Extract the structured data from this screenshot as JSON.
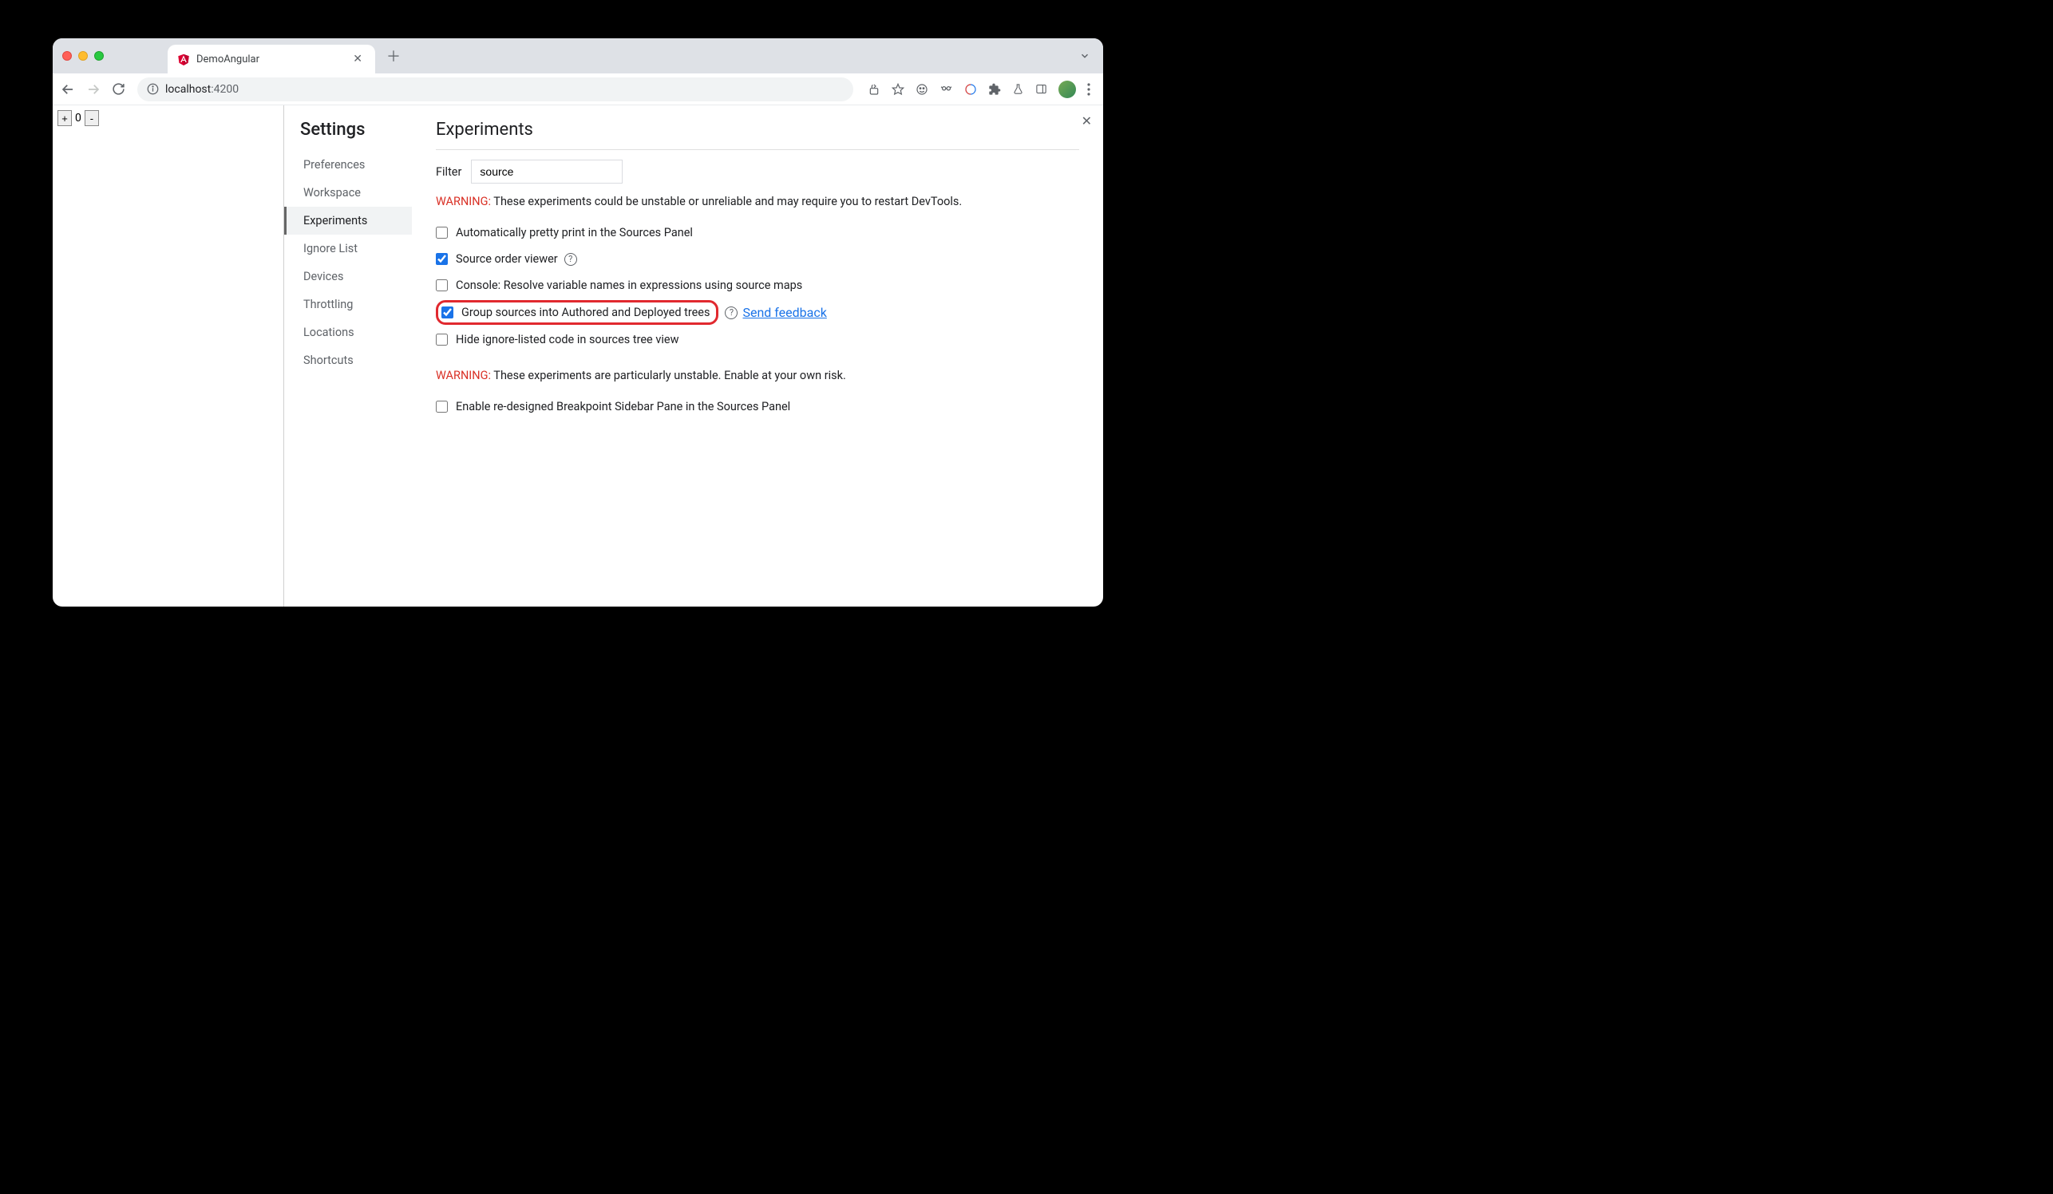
{
  "browser": {
    "tab_title": "DemoAngular",
    "url_host": "localhost",
    "url_port": ":4200"
  },
  "page": {
    "counter_value": "0"
  },
  "settings": {
    "title": "Settings",
    "sidebar": [
      {
        "label": "Preferences",
        "active": false
      },
      {
        "label": "Workspace",
        "active": false
      },
      {
        "label": "Experiments",
        "active": true
      },
      {
        "label": "Ignore List",
        "active": false
      },
      {
        "label": "Devices",
        "active": false
      },
      {
        "label": "Throttling",
        "active": false
      },
      {
        "label": "Locations",
        "active": false
      },
      {
        "label": "Shortcuts",
        "active": false
      }
    ]
  },
  "experiments": {
    "heading": "Experiments",
    "filter_label": "Filter",
    "filter_value": "source",
    "warning1_label": "WARNING:",
    "warning1_text": " These experiments could be unstable or unreliable and may require you to restart DevTools.",
    "items": [
      {
        "label": "Automatically pretty print in the Sources Panel",
        "checked": false,
        "help": false
      },
      {
        "label": "Source order viewer",
        "checked": true,
        "help": true
      },
      {
        "label": "Console: Resolve variable names in expressions using source maps",
        "checked": false,
        "help": false
      },
      {
        "label": "Group sources into Authored and Deployed trees",
        "checked": true,
        "help": true,
        "feedback": true,
        "highlighted": true
      },
      {
        "label": "Hide ignore-listed code in sources tree view",
        "checked": false,
        "help": false
      }
    ],
    "feedback_text": "Send feedback",
    "warning2_label": "WARNING:",
    "warning2_text": " These experiments are particularly unstable. Enable at your own risk.",
    "items2": [
      {
        "label": "Enable re-designed Breakpoint Sidebar Pane in the Sources Panel",
        "checked": false
      }
    ]
  }
}
